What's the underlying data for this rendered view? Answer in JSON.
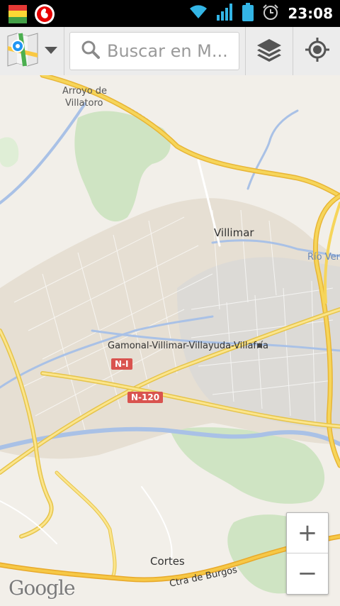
{
  "status_bar": {
    "time": "23:08",
    "icons": [
      "app-notification-icon",
      "vodafone-icon",
      "wifi-icon",
      "signal-icon",
      "battery-icon",
      "alarm-icon"
    ]
  },
  "action_bar": {
    "search_placeholder": "Buscar en M...",
    "icons": [
      "maps-app-icon",
      "dropdown-arrow-icon",
      "search-icon",
      "layers-icon",
      "my-location-icon"
    ]
  },
  "map": {
    "labels": {
      "arroyo_line1": "Arroyo de",
      "arroyo_line2": "Villatoro",
      "villimar": "Villimar",
      "rio_vena": "Río Vena",
      "gamonal": "Gamonal-Villimar-Villayuda-Villafría",
      "cortes": "Cortes",
      "ctra_burgos": "Ctra de Burgos"
    },
    "road_shields": {
      "n1": "N-I",
      "n120": "N-120"
    },
    "colors": {
      "land": "#f2efe9",
      "urban": "#e6dfd3",
      "industrial": "#dcdad6",
      "park": "#cfe4c3",
      "water": "#a9c1e6",
      "highway": "#f6c846",
      "major_road": "#fbe58c"
    }
  },
  "zoom": {
    "zoom_in": "+",
    "zoom_out": "−"
  },
  "logo": "Google"
}
